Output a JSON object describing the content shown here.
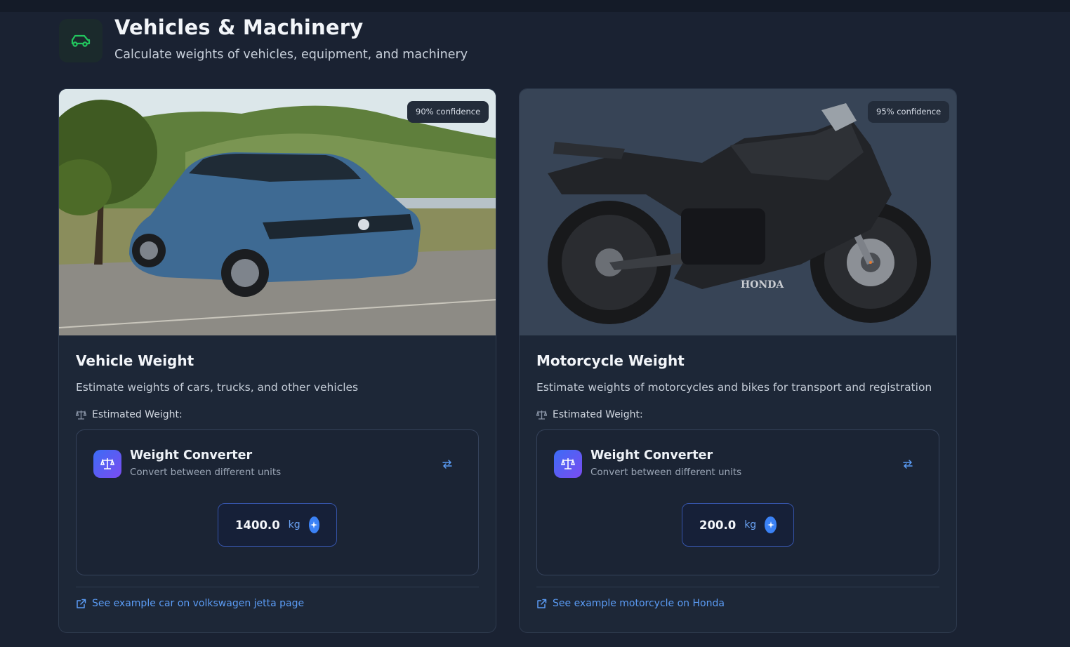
{
  "header": {
    "title": "Vehicles & Machinery",
    "subtitle": "Calculate weights of vehicles, equipment, and machinery",
    "icon": "car-icon",
    "icon_color": "#22c55e"
  },
  "cards": [
    {
      "image_alt": "Blue Volkswagen Jetta sedan on a road with hills",
      "confidence": "90% confidence",
      "title": "Vehicle Weight",
      "description": "Estimate weights of cars, trucks, and other vehicles",
      "estimated_label": "Estimated Weight:",
      "converter": {
        "title": "Weight Converter",
        "subtitle": "Convert between different units",
        "value": "1400.0",
        "unit": "kg"
      },
      "link_text": "See example car on volkswagen jetta page"
    },
    {
      "image_alt": "Black Honda sport motorcycle",
      "confidence": "95% confidence",
      "title": "Motorcycle Weight",
      "description": "Estimate weights of motorcycles and bikes for transport and registration",
      "estimated_label": "Estimated Weight:",
      "converter": {
        "title": "Weight Converter",
        "subtitle": "Convert between different units",
        "value": "200.0",
        "unit": "kg"
      },
      "link_text": "See example motorcycle on Honda"
    }
  ],
  "colors": {
    "accent": "#3b82f6",
    "link": "#5b9cf5",
    "background": "#1a2232",
    "card": "#1d2737"
  }
}
